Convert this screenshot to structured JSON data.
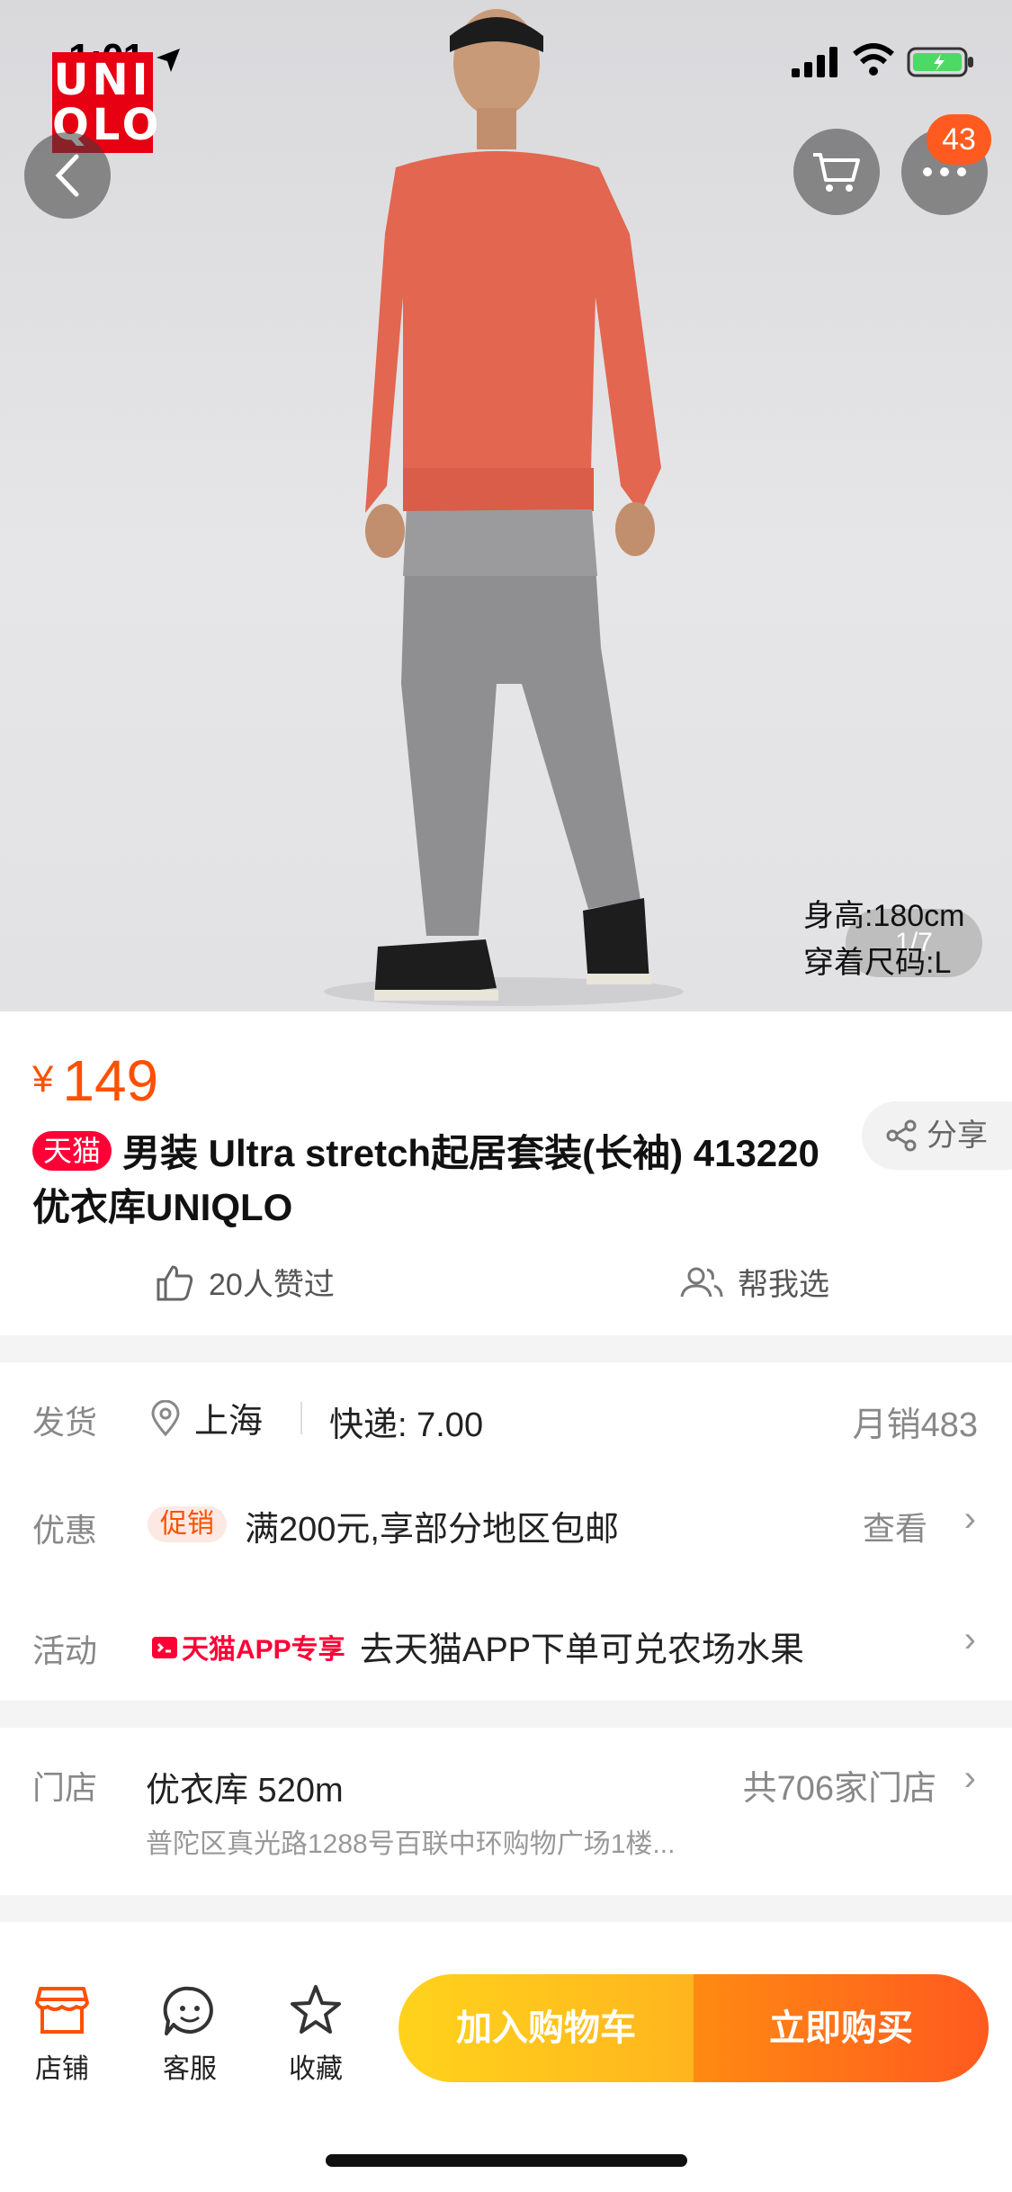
{
  "status_bar": {
    "time": "1:01"
  },
  "brand": {
    "logo_text": "UNI\nQLO"
  },
  "nav": {
    "cart_badge": "43"
  },
  "gallery": {
    "model_height": "身高:180cm",
    "model_size": "穿着尺码:L",
    "pager": "1/7"
  },
  "product": {
    "currency": "¥",
    "price": "149",
    "tag": "天猫",
    "title": "男装 Ultra stretch起居套装(长袖) 413220 优衣库UNIQLO",
    "share_label": "分享",
    "likes_label": "20人赞过",
    "help_label": "帮我选"
  },
  "shipping": {
    "label": "发货",
    "origin": "上海",
    "fee": "快递: 7.00",
    "monthly_sales": "月销483",
    "promo_label": "优惠",
    "promo_tag": "促销",
    "promo_text": "满200元,享部分地区包邮",
    "promo_view": "查看",
    "activity_label": "活动",
    "activity_tag": "天猫APP专享",
    "activity_text": "去天猫APP下单可兑农场水果"
  },
  "store": {
    "label": "门店",
    "name": "优衣库  520m",
    "count": "共706家门店",
    "address": "普陀区真光路1288号百联中环购物广场1楼..."
  },
  "bottom_bar": {
    "store_label": "店铺",
    "service_label": "客服",
    "favorite_label": "收藏",
    "add_cart_label": "加入购物车",
    "buy_now_label": "立即购买"
  },
  "colors": {
    "accent": "#ff5000",
    "tmall_red": "#ff0036",
    "cart_yellow": "#ffc21c",
    "buy_orange": "#ff6a18"
  }
}
